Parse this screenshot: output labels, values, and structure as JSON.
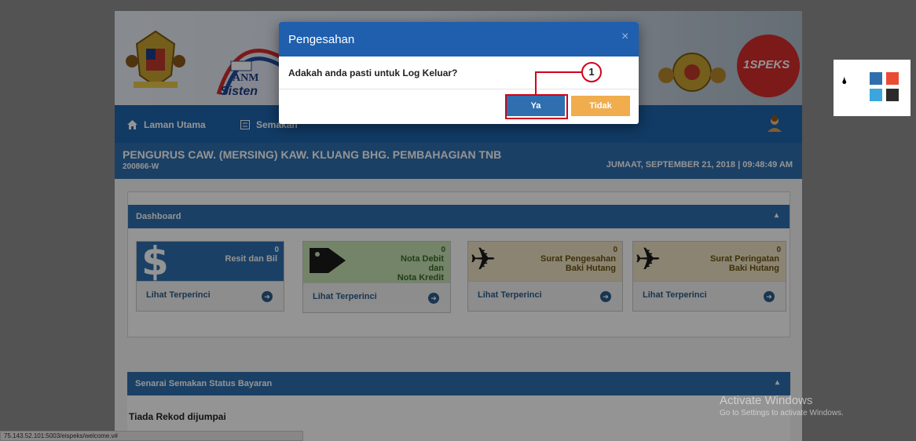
{
  "banner": {
    "logo_text_1": "ANM",
    "logo_text_2": "Sisten",
    "brand": "1SPEKS"
  },
  "nav": {
    "home_label": "Laman Utama",
    "second_label": "Semakan"
  },
  "header": {
    "org_title": "PENGURUS CAW. (MERSING) KAW. KLUANG BHG. PEMBAHAGIAN TNB",
    "org_code": "200866-W",
    "datetime": "JUMAAT, SEPTEMBER 21, 2018 | 09:48:49 AM"
  },
  "dashboard": {
    "title": "Dashboard",
    "tiles": [
      {
        "count": "0",
        "label_1": "Resit dan Bil",
        "label_2": "",
        "label_3": "",
        "link": "Lihat Terperinci"
      },
      {
        "count": "0",
        "label_1": "Nota Debit",
        "label_2": "dan",
        "label_3": "Nota Kredit",
        "link": "Lihat Terperinci"
      },
      {
        "count": "0",
        "label_1": "Surat Pengesahan",
        "label_2": "Baki Hutang",
        "label_3": "",
        "link": "Lihat Terperinci"
      },
      {
        "count": "0",
        "label_1": "Surat Peringatan",
        "label_2": "Baki Hutang",
        "label_3": "",
        "link": "Lihat Terperinci"
      }
    ]
  },
  "status_panel": {
    "title": "Senarai Semakan Status Bayaran",
    "empty_text": "Tiada Rekod dijumpai"
  },
  "modal": {
    "title": "Pengesahan",
    "close_symbol": "×",
    "message": "Adakah anda pasti untuk Log Keluar?",
    "yes_label": "Ya",
    "no_label": "Tidak"
  },
  "annotation": {
    "step_number": "1",
    "color": "#d0021b"
  },
  "watermark": {
    "line1": "Activate Windows",
    "line2": "Go to Settings to activate Windows."
  },
  "status_url": "75.143.52.101:5003/eispeks/welcome.v#",
  "palette": {
    "colors": [
      "#2f6fae",
      "#e94b35",
      "#3aa6dd",
      "#2b2b2b"
    ]
  },
  "colors": {
    "primary": "#1f5fad",
    "yes_button": "#2f6fb0",
    "no_button": "#f0ad4e"
  }
}
